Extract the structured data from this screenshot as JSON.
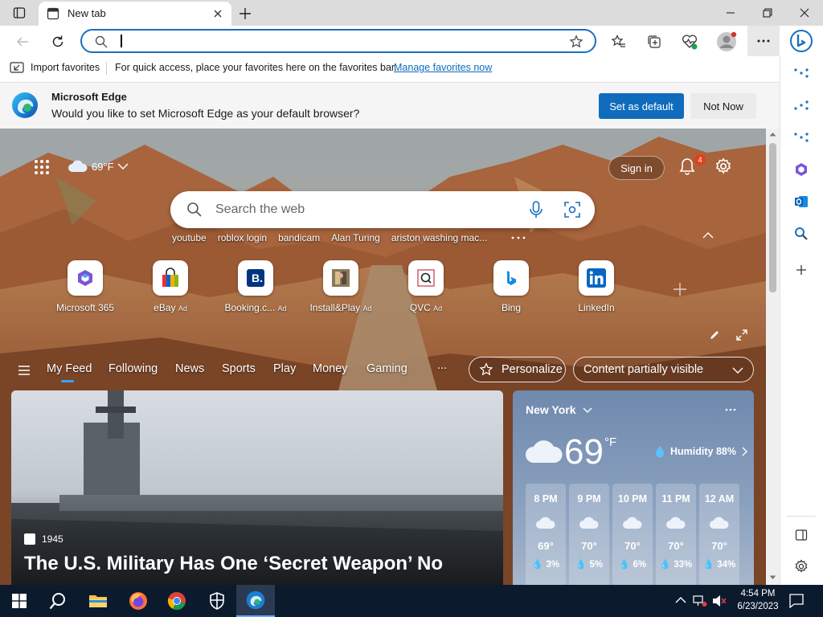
{
  "window": {
    "tab_title": "New tab"
  },
  "toolbar": {
    "address_value": "",
    "address_placeholder": ""
  },
  "favbar": {
    "import_label": "Import favorites",
    "hint": "For quick access, place your favorites here on the favorites bar.",
    "manage_link": "Manage favorites now"
  },
  "banner": {
    "title": "Microsoft Edge",
    "message": "Would you like to set Microsoft Edge as your default browser?",
    "set_default": "Set as default",
    "not_now": "Not Now"
  },
  "ntp": {
    "weather_temp": "69°F",
    "sign_in": "Sign in",
    "notification_count": "4",
    "search_placeholder": "Search the web",
    "trending": [
      "youtube",
      "roblox login",
      "bandicam",
      "Alan Turing",
      "ariston washing mac..."
    ],
    "tiles": [
      {
        "label": "Microsoft 365",
        "ad": ""
      },
      {
        "label": "eBay",
        "ad": "Ad"
      },
      {
        "label": "Booking.c...",
        "ad": "Ad"
      },
      {
        "label": "Install&Play",
        "ad": "Ad"
      },
      {
        "label": "QVC",
        "ad": "Ad"
      },
      {
        "label": "Bing",
        "ad": ""
      },
      {
        "label": "LinkedIn",
        "ad": ""
      }
    ],
    "nav": [
      "My Feed",
      "Following",
      "News",
      "Sports",
      "Play",
      "Money",
      "Gaming"
    ],
    "more": "...",
    "personalize": "Personalize",
    "content_visibility": "Content partially visible"
  },
  "news": {
    "source": "1945",
    "headline": "The U.S. Military Has One ‘Secret Weapon’ No"
  },
  "weather": {
    "city": "New York",
    "temp": "69",
    "unit": "°F",
    "humidity": "Humidity 88%",
    "hours": [
      {
        "time": "8 PM",
        "temp": "69°",
        "precip": "3%"
      },
      {
        "time": "9 PM",
        "temp": "70°",
        "precip": "5%"
      },
      {
        "time": "10 PM",
        "temp": "70°",
        "precip": "6%"
      },
      {
        "time": "11 PM",
        "temp": "70°",
        "precip": "33%"
      },
      {
        "time": "12 AM",
        "temp": "70°",
        "precip": "34%"
      }
    ]
  },
  "taskbar": {
    "time": "4:54 PM",
    "date": "6/23/2023"
  },
  "colors": {
    "accent": "#0f6cbd",
    "taskbar": "#0c1a2e",
    "link": "#0f6cbd"
  }
}
